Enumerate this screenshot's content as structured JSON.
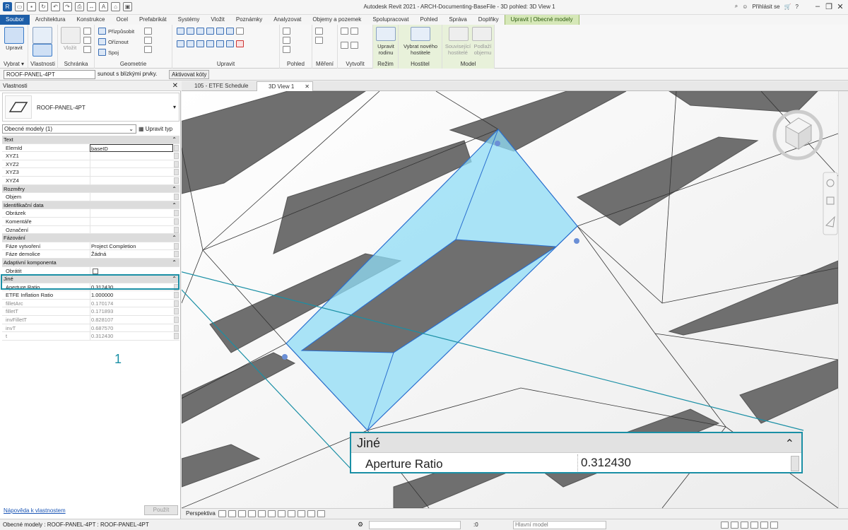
{
  "app": {
    "title": "Autodesk Revit 2021 - ARCH-Documenting-BaseFile - 3D pohled: 3D View 1",
    "signin": "Přihlásit se"
  },
  "tabs": [
    "Soubor",
    "Architektura",
    "Konstrukce",
    "Ocel",
    "Prefabrikát",
    "Systémy",
    "Vložit",
    "Poznámky",
    "Analyzovat",
    "Objemy a pozemek",
    "Spolupracovat",
    "Pohled",
    "Správa",
    "Doplňky",
    "Upravit | Obecné modely"
  ],
  "ribbon": {
    "modify_label": "Upravit",
    "select_label": "Vybrat ▾",
    "properties_label": "Vlastnosti",
    "paste_label": "Vložit",
    "clipboard_label": "Schránka",
    "geometry": {
      "cope": "Přizpůsobit",
      "cut": "Oříznout",
      "join": "Spoj",
      "label": "Geometrie"
    },
    "modify_panel_label": "Upravit",
    "view_label": "Pohled",
    "measure_label": "Měření",
    "create_label": "Vytvořit",
    "edit_family": "Upravit rodinu",
    "mode_label": "Režim",
    "pick_host": "Vybrat nového hostitele",
    "host_label": "Hostitel",
    "related_host": "Související hostitelé",
    "below_mass": "Podlaží objemu",
    "model_label": "Model"
  },
  "options": {
    "type": "ROOF-PANEL-4PT",
    "message": "sunout s blízkými prvky.",
    "dims_button": "Aktivovat kóty"
  },
  "properties": {
    "title": "Vlastnosti",
    "type_name": "ROOF-PANEL-4PT",
    "filter": "Obecné modely (1)",
    "edit_type": "Upravit typ",
    "sections": [
      {
        "name": "Text",
        "rows": [
          {
            "name": "ElemId",
            "value": "baseID"
          },
          {
            "name": "XYZ1",
            "value": ""
          },
          {
            "name": "XYZ2",
            "value": ""
          },
          {
            "name": "XYZ3",
            "value": ""
          },
          {
            "name": "XYZ4",
            "value": ""
          }
        ]
      },
      {
        "name": "Rozměry",
        "rows": [
          {
            "name": "Objem",
            "value": ""
          }
        ]
      },
      {
        "name": "Identifikační data",
        "rows": [
          {
            "name": "Obrázek",
            "value": ""
          },
          {
            "name": "Komentáře",
            "value": ""
          },
          {
            "name": "Označení",
            "value": ""
          }
        ]
      },
      {
        "name": "Fázování",
        "rows": [
          {
            "name": "Fáze vytvoření",
            "value": "Project Completion"
          },
          {
            "name": "Fáze demolice",
            "value": "Žádná"
          }
        ]
      },
      {
        "name": "Adaptivní komponenta",
        "rows": [
          {
            "name": "Obrátit",
            "value": ""
          }
        ]
      },
      {
        "name": "Jiné",
        "rows": [
          {
            "name": "Aperture Ratio",
            "value": "0.312430"
          },
          {
            "name": "ETFE Inflation Ratio",
            "value": "1.000000"
          },
          {
            "name": "filletArc",
            "value": "0.170174"
          },
          {
            "name": "filletT",
            "value": "0.171893"
          },
          {
            "name": "invFilletT",
            "value": "0.828107"
          },
          {
            "name": "invT",
            "value": "0.687570"
          },
          {
            "name": "t",
            "value": "0.312430"
          }
        ]
      }
    ],
    "help": "Nápověda k vlastnostem",
    "apply": "Použít"
  },
  "doc_tabs": [
    "105 - ETFE Schedule",
    "3D View 1"
  ],
  "viewbar": {
    "mode": "Perspektiva"
  },
  "status": {
    "text": "Obecné modely : ROOF-PANEL-4PT : ROOF-PANEL-4PT",
    "selected": ":0",
    "model": "Hlavní model"
  },
  "callout": {
    "number": "1",
    "section": "Jiné",
    "name": "Aperture Ratio",
    "value": "0.312430"
  },
  "colors": {
    "accent": "#1a8fa5",
    "file_tab": "#1d5ea8",
    "selection": "#7fd8f5"
  }
}
